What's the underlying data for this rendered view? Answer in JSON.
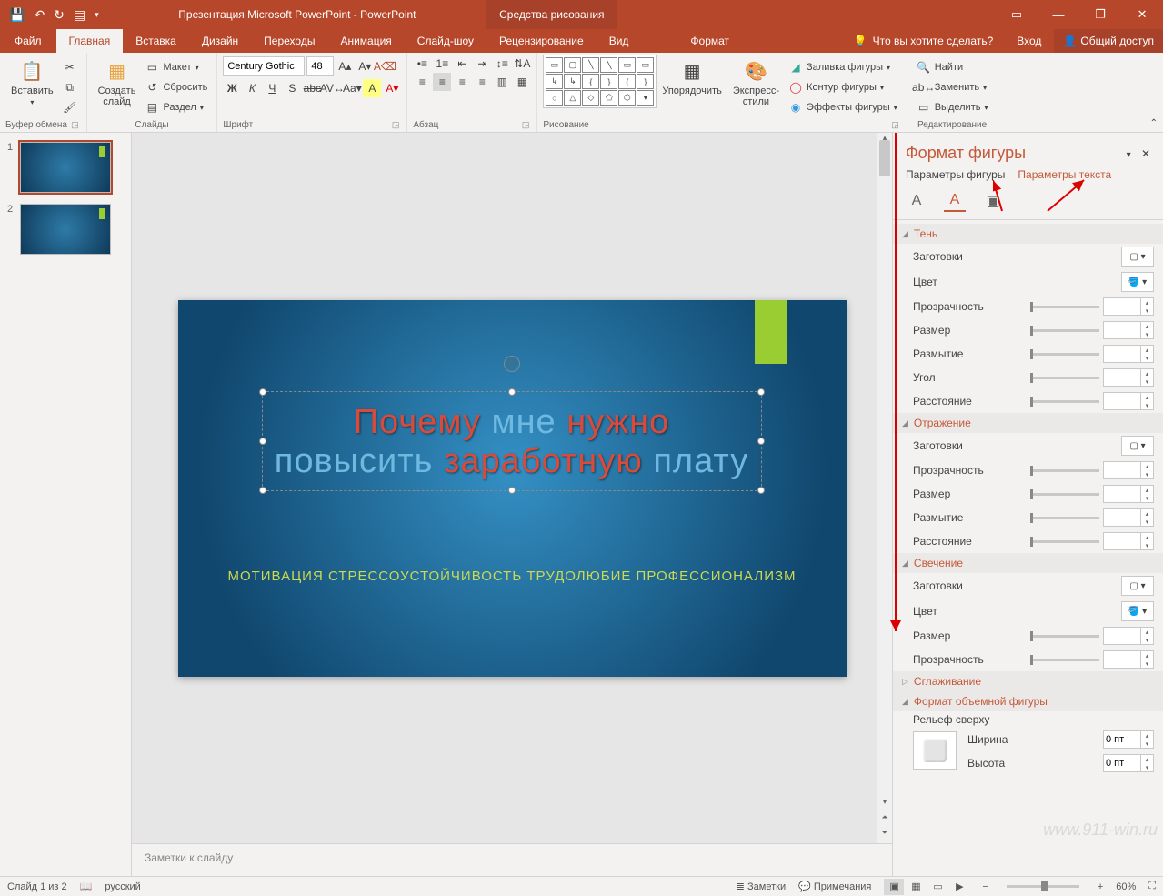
{
  "titlebar": {
    "doc_title": "Презентация Microsoft PowerPoint - PowerPoint",
    "drawing_tools": "Средства рисования"
  },
  "tabs": {
    "file": "Файл",
    "home": "Главная",
    "insert": "Вставка",
    "design": "Дизайн",
    "transitions": "Переходы",
    "animations": "Анимация",
    "slideshow": "Слайд-шоу",
    "review": "Рецензирование",
    "view": "Вид",
    "format": "Формат",
    "tell_me": "Что вы хотите сделать?",
    "signin": "Вход",
    "share": "Общий доступ"
  },
  "ribbon": {
    "clipboard": {
      "label": "Буфер обмена",
      "paste": "Вставить"
    },
    "slides": {
      "label": "Слайды",
      "new_slide": "Создать\nслайд",
      "layout": "Макет",
      "reset": "Сбросить",
      "section": "Раздел"
    },
    "font": {
      "label": "Шрифт",
      "name": "Century Gothic",
      "size": "48"
    },
    "paragraph": {
      "label": "Абзац"
    },
    "drawing": {
      "label": "Рисование",
      "arrange": "Упорядочить",
      "quick_styles": "Экспресс-\nстили",
      "fill": "Заливка фигуры",
      "outline": "Контур фигуры",
      "effects": "Эффекты фигуры"
    },
    "editing": {
      "label": "Редактирование",
      "find": "Найти",
      "replace": "Заменить",
      "select": "Выделить"
    }
  },
  "slide": {
    "line1_r1": "Почему ",
    "line1_b": "мне ",
    "line1_r2": "нужно",
    "line2_b1": "повысить ",
    "line2_r": "заработную ",
    "line2_b2": "плату",
    "subtitle": "МОТИВАЦИЯ СТРЕССОУСТОЙЧИВОСТЬ ТРУДОЛЮБИЕ ПРОФЕССИОНАЛИЗМ"
  },
  "notes_placeholder": "Заметки к слайду",
  "pane": {
    "title": "Формат фигуры",
    "shape_opts": "Параметры фигуры",
    "text_opts": "Параметры текста",
    "shadow": "Тень",
    "reflection": "Отражение",
    "glow": "Свечение",
    "soft_edges": "Сглаживание",
    "format_3d": "Формат объемной фигуры",
    "presets": "Заготовки",
    "color": "Цвет",
    "transparency": "Прозрачность",
    "size": "Размер",
    "blur": "Размытие",
    "angle": "Угол",
    "distance": "Расстояние",
    "top_bevel": "Рельеф сверху",
    "width": "Ширина",
    "height": "Высота",
    "zero_pt": "0 пт"
  },
  "status": {
    "slide_count": "Слайд 1 из 2",
    "language": "русский",
    "notes": "Заметки",
    "comments": "Примечания",
    "zoom": "60%"
  },
  "watermark": "www.911-win.ru",
  "thumbs": {
    "n1": "1",
    "n2": "2"
  }
}
